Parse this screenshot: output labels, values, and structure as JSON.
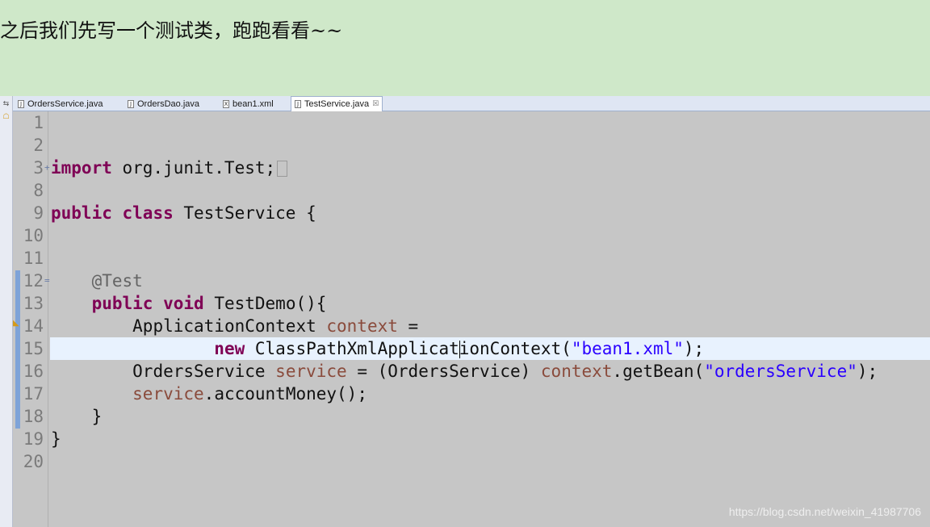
{
  "intro_text": "之后我们先写一个测试类，跑跑看看~~",
  "tabs": [
    {
      "label": "OrdersService.java",
      "icon": "java-file-icon"
    },
    {
      "label": "OrdersDao.java",
      "icon": "java-file-icon"
    },
    {
      "label": "bean1.xml",
      "icon": "xml-file-icon"
    },
    {
      "label": "TestService.java",
      "icon": "java-file-icon",
      "active": true,
      "close": "☒"
    }
  ],
  "editor": {
    "line_numbers": [
      "1",
      "2",
      "3",
      "8",
      "9",
      "10",
      "11",
      "12",
      "13",
      "14",
      "15",
      "16",
      "17",
      "18",
      "19",
      "20"
    ],
    "current_line": "15",
    "tokens": {
      "l3_kw": "import",
      "l3_rest": " org.junit.Test;",
      "l9_kw1": "public",
      "l9_kw2": "class",
      "l9_rest": " TestService {",
      "l12_ann": "@Test",
      "l13_kw1": "public",
      "l13_kw2": "void",
      "l13_rest": " TestDemo(){",
      "l14_type": "ApplicationContext ",
      "l14_var": "context",
      "l14_rest": " =",
      "l15_kw": "new",
      "l15_a": " ClassPathXmlApplicat",
      "l15_b": "ionContext(",
      "l15_str": "\"bean1.xml\"",
      "l15_end": ");",
      "l16_type": "OrdersService ",
      "l16_var": "service",
      "l16_mid": " = (OrdersService) ",
      "l16_var2": "context",
      "l16_call": ".getBean(",
      "l16_str": "\"ordersService\"",
      "l16_end": ");",
      "l17_var": "service",
      "l17_rest": ".accountMoney();",
      "l18": "}",
      "l19": "}"
    }
  },
  "watermark": "https://blog.csdn.net/weixin_41987706",
  "colors": {
    "background": "#cfe8c9",
    "editor_bg": "#c6c6c6",
    "keyword": "#7f0055",
    "string": "#2a00ff",
    "field": "#8a4b3c",
    "annotation": "#646464",
    "current_line": "#e8f2fe"
  }
}
